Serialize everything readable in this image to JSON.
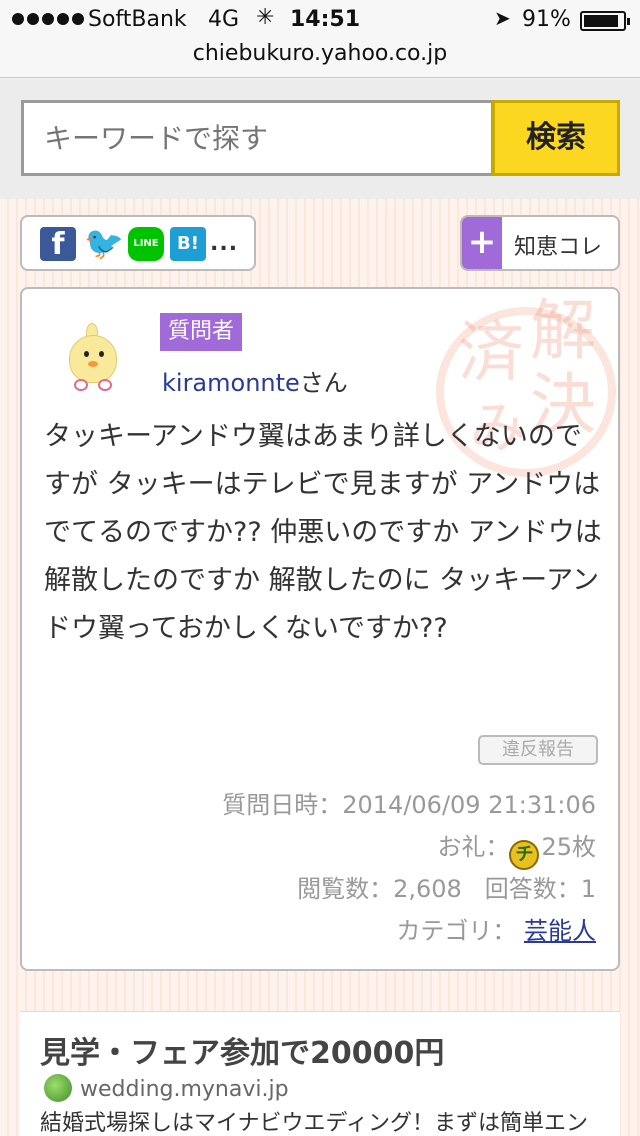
{
  "status_bar": {
    "carrier": "SoftBank",
    "network": "4G",
    "time": "14:51",
    "battery": "91%"
  },
  "url": "chiebukuro.yahoo.co.jp",
  "search": {
    "placeholder": "キーワードで探す",
    "button_label": "検索"
  },
  "share": {
    "icons": [
      "facebook-icon",
      "twitter-icon",
      "line-icon",
      "hatena-bookmark-icon"
    ],
    "line_text": "LINE",
    "hatena_text": "B!",
    "more_label": "..."
  },
  "chie_collection": {
    "plus": "+",
    "label": "知恵コレ"
  },
  "stamp": {
    "chars": [
      "解",
      "決",
      "済",
      "み"
    ]
  },
  "question": {
    "badge": "質問者",
    "username": "kiramonnte",
    "honorific": "さん",
    "text": "タッキーアンドウ翼はあまり詳しくないのですが タッキーはテレビで見ますが アンドウはでてるのですか?? 仲悪いのですか アンドウは解散したのですか 解散したのに タッキーアンドウ翼っておかしくないですか??",
    "report_label": "違反報告",
    "date_label": "質問日時：2014/06/09 21:31:06",
    "reward_prefix": "お礼：",
    "coin_char": "チ",
    "reward_value": "25枚",
    "views_label": "閲覧数：2,608",
    "answers_label": "回答数：1",
    "category_prefix": "カテゴリ：",
    "category": "芸能人"
  },
  "ad": {
    "title": "見学・フェア参加で20000円",
    "site": "wedding.mynavi.jp",
    "description": "結婚式場探しはマイナビウエディング！まずは簡単エントリーからスタート"
  }
}
